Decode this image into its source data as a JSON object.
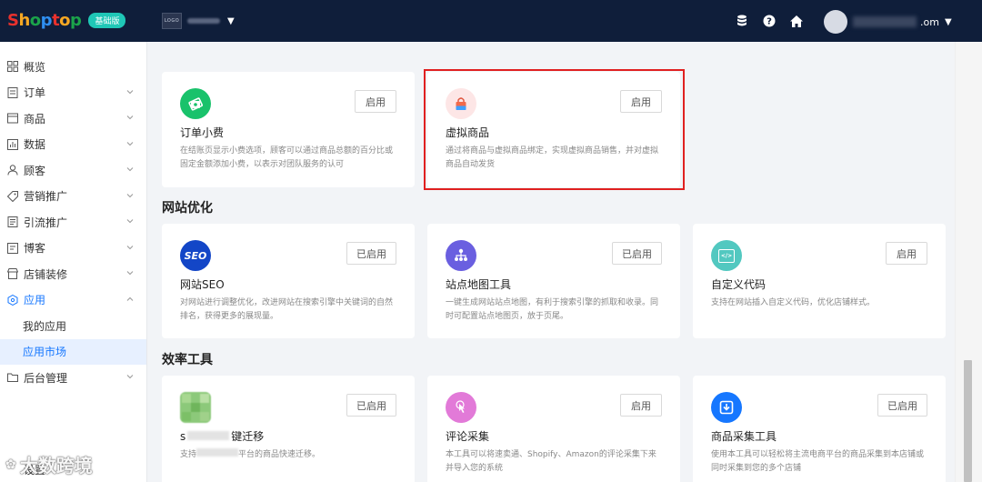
{
  "brand": {
    "name_letters": [
      "S",
      "h",
      "o",
      "p",
      "t",
      "o",
      "p"
    ],
    "name_colors": [
      "#e8312d",
      "#f7a823",
      "#1ba34a",
      "#2f8ff0",
      "#e8312d",
      "#f7a823",
      "#1ba34a"
    ],
    "plan_badge": "基础版"
  },
  "header": {
    "store_logo_text": "LOGO",
    "user_suffix": ".om"
  },
  "sidebar": {
    "items": [
      {
        "label": "概览",
        "icon": "dashboard-icon",
        "chevron": false
      },
      {
        "label": "订单",
        "icon": "order-icon",
        "chevron": true
      },
      {
        "label": "商品",
        "icon": "product-icon",
        "chevron": true
      },
      {
        "label": "数据",
        "icon": "chart-icon",
        "chevron": true
      },
      {
        "label": "顾客",
        "icon": "user-icon",
        "chevron": true
      },
      {
        "label": "营销推广",
        "icon": "tag-icon",
        "chevron": true
      },
      {
        "label": "引流推广",
        "icon": "traffic-icon",
        "chevron": true
      },
      {
        "label": "博客",
        "icon": "blog-icon",
        "chevron": true
      },
      {
        "label": "店铺装修",
        "icon": "store-icon",
        "chevron": true
      },
      {
        "label": "应用",
        "icon": "app-icon",
        "chevron": true,
        "open": true
      }
    ],
    "sub_items": [
      "我的应用",
      "应用市场"
    ],
    "active_sub": "应用市场",
    "after_items": [
      {
        "label": "后台管理",
        "icon": "folder-icon",
        "chevron": true
      }
    ],
    "bottom_item": "设置"
  },
  "sections": {
    "seo_title": "网站优化",
    "efficiency_title": "效率工具"
  },
  "cards": {
    "order_fee": {
      "title": "订单小费",
      "desc": "在结账页显示小费选项，顾客可以通过商品总额的百分比或固定金额添加小费，以表示对团队服务的认可",
      "button": "启用",
      "color": "#19c26b"
    },
    "virtual": {
      "title": "虚拟商品",
      "desc": "通过将商品与虚拟商品绑定，实现虚拟商品销售，并对虚拟商品自动发货",
      "button": "启用",
      "color": "#fde6e6"
    },
    "seo": {
      "title": "网站SEO",
      "desc": "对网站进行调整优化，改进网站在搜索引擎中关键词的自然排名，获得更多的展现量。",
      "button": "已启用",
      "icon_text": "SEO",
      "color": "#1346c7"
    },
    "sitemap": {
      "title": "站点地图工具",
      "desc": "一键生成网站站点地图，有利于搜索引擎的抓取和收录。同时可配置站点地图页，放于页尾。",
      "button": "已启用",
      "color": "#6a5fe0"
    },
    "custom_code": {
      "title": "自定义代码",
      "desc": "支持在网站插入自定义代码，优化店铺样式。",
      "button": "启用",
      "icon_text": "</>",
      "color": "#52c8c0"
    },
    "migrate": {
      "title_prefix": "s",
      "title_suffix": "键迁移",
      "desc_prefix": "支持",
      "desc_suffix": "平台的商品快速迁移。",
      "button": "已启用",
      "color": "#8cc97a"
    },
    "review": {
      "title": "评论采集",
      "desc": "本工具可以将速卖通、Shopify、Amazon的评论采集下来并导入您的系统",
      "button": "启用",
      "color": "#e27ad8"
    },
    "product_collect": {
      "title": "商品采集工具",
      "desc": "使用本工具可以轻松将主流电商平台的商品采集到本店铺或同时采集到您的多个店铺",
      "button": "已启用",
      "color": "#1677ff"
    }
  },
  "watermark": "大数跨境"
}
